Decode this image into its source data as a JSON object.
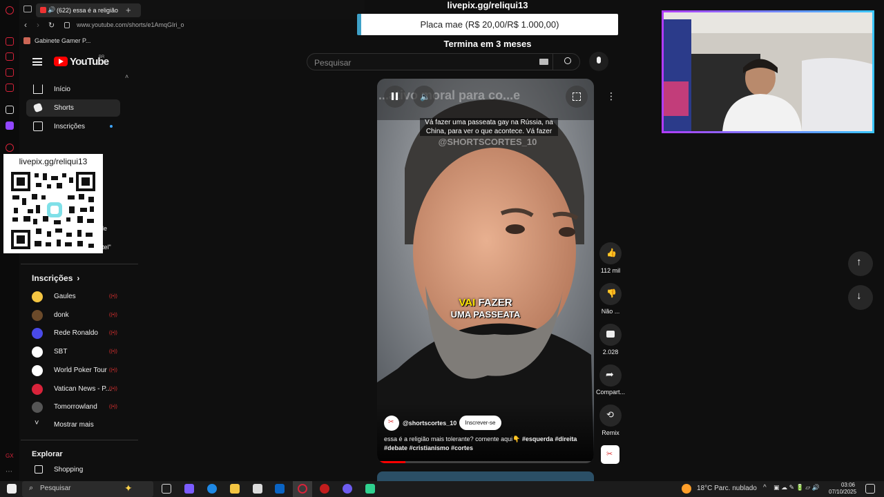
{
  "browser": {
    "tab_title": "(622) essa é a religião",
    "url": "www.youtube.com/shorts/e1AmqGIri_o",
    "bookmark": "Gabinete Gamer P..."
  },
  "youtube": {
    "logo_text": "YouTube",
    "logo_region": "BR",
    "search_placeholder": "Pesquisar"
  },
  "sidebar": {
    "items": [
      {
        "label": "Início"
      },
      {
        "label": "Shorts"
      },
      {
        "label": "Inscrições"
      }
    ],
    "fragment_text_1": "le",
    "fragment_text_2": "tel\"",
    "subs_header": "Inscrições",
    "subs": [
      {
        "label": "Gaules",
        "color": "#f4c542"
      },
      {
        "label": "donk",
        "color": "#6b4a2a"
      },
      {
        "label": "Rede Ronaldo",
        "color": "#4a4ae8"
      },
      {
        "label": "SBT",
        "color": "#ffffff"
      },
      {
        "label": "World Poker Tour",
        "color": "#ffffff"
      },
      {
        "label": "Vatican News - P...",
        "color": "#d8233a"
      },
      {
        "label": "Tomorrowland",
        "color": "#555555"
      }
    ],
    "show_more": "Mostrar mais",
    "explore_header": "Explorar",
    "shopping": "Shopping"
  },
  "overlay": {
    "qr_url": "livepix.gg/reliqui13",
    "donation_url": "livepix.gg/reliqui13",
    "goal_label": "Placa mae (R$ 20,00/R$ 1.000,00)",
    "goal_end": "Termina em 3 meses"
  },
  "video": {
    "top_title": "...ativo moral para co...e",
    "top_caption": "Vá fazer uma passeata gay na Rússia, na China, para ver o que acontece. Vá fazer",
    "watermark": "@SHORTSCORTES_10",
    "caption_highlight": "VAI",
    "caption_line1": "FAZER",
    "caption_line2": "UMA PASSEATA",
    "channel": "@shortscortes_10",
    "subscribe": "Inscrever-se",
    "description": "essa é a religião mais tolerante? comente aqui👇",
    "tags_line1": "#esquerda #direita",
    "tags_line2": "#debate  #cristianismo #cortes",
    "progress": 0.13
  },
  "actions": {
    "likes": "112 mil",
    "dislike": "Não ...",
    "comments": "2.028",
    "share": "Compart...",
    "remix": "Remix"
  },
  "taskbar": {
    "search": "Pesquisar",
    "weather": "18°C  Parc. nublado",
    "time": "03:06",
    "date": "07/10/2025"
  }
}
